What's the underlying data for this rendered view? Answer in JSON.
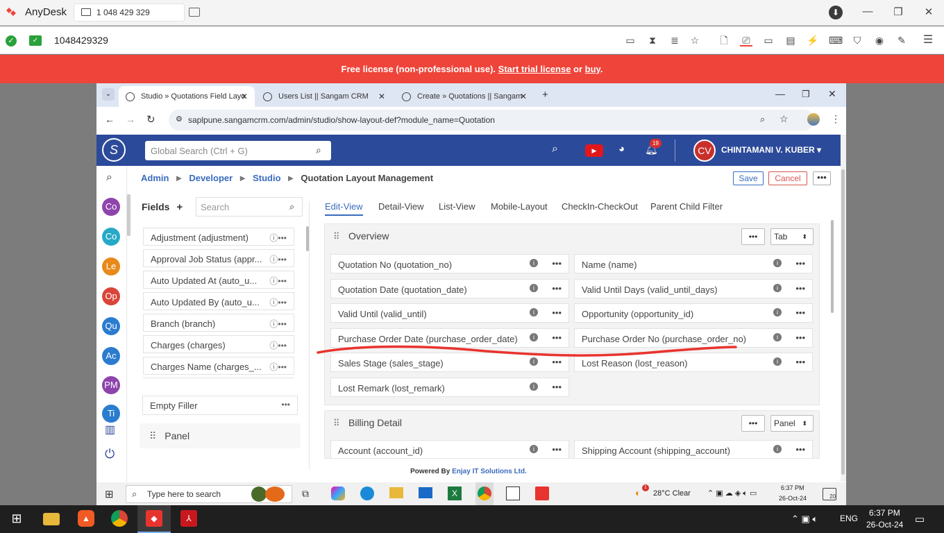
{
  "anydesk": {
    "app_title": "AnyDesk",
    "tab_label": "1 048 429 329",
    "address": "1048429329",
    "banner_prefix": "Free license (non-professional use). ",
    "banner_link1": "Start trial license",
    "banner_mid": " or ",
    "banner_link2": "buy",
    "banner_suffix": "."
  },
  "browser": {
    "tabs": [
      {
        "label": "Studio » Quotations Field Layo"
      },
      {
        "label": "Users List || Sangam CRM"
      },
      {
        "label": "Create » Quotations || Sangam"
      }
    ],
    "url": "saplpune.sangamcrm.com/admin/studio/show-layout-def?module_name=Quotation"
  },
  "crm": {
    "search_placeholder": "Global Search (Ctrl + G)",
    "notification_count": "19",
    "avatar_initials": "CV",
    "user_name": "CHINTAMANI V. KUBER",
    "rail_items": [
      {
        "label": "Co",
        "color": "#8e44ad"
      },
      {
        "label": "Co",
        "color": "#26a9c7"
      },
      {
        "label": "Le",
        "color": "#e8891a"
      },
      {
        "label": "Op",
        "color": "#d9453a"
      },
      {
        "label": "Qu",
        "color": "#2a7ccf"
      },
      {
        "label": "Ac",
        "color": "#2a7ccf"
      },
      {
        "label": "PM",
        "color": "#8e44ad"
      },
      {
        "label": "Ti",
        "color": "#2a7ccf"
      }
    ],
    "breadcrumb": {
      "admin": "Admin",
      "developer": "Developer",
      "studio": "Studio",
      "current": "Quotation Layout Management"
    },
    "actions": {
      "save": "Save",
      "cancel": "Cancel",
      "more": "•••"
    },
    "fields_title": "Fields",
    "fields_search": "Search",
    "field_list": [
      "Adjustment (adjustment)",
      "Approval Job Status (appr...",
      "Auto Updated At (auto_u...",
      "Auto Updated By (auto_u...",
      "Branch (branch)",
      "Charges (charges)",
      "Charges Name (charges_..."
    ],
    "empty_filler": "Empty Filler",
    "panel_label": "Panel",
    "view_tabs": [
      "Edit-View",
      "Detail-View",
      "List-View",
      "Mobile-Layout",
      "CheckIn-CheckOut",
      "Parent Child Filter"
    ],
    "overview": {
      "title": "Overview",
      "type": "Tab",
      "rows": [
        [
          "Quotation No (quotation_no)",
          "Name (name)"
        ],
        [
          "Quotation Date (quotation_date)",
          "Valid Until Days (valid_until_days)"
        ],
        [
          "Valid Until (valid_until)",
          "Opportunity (opportunity_id)"
        ],
        [
          "Purchase Order Date (purchase_order_date)",
          "Purchase Order No (purchase_order_no)"
        ],
        [
          "Sales Stage (sales_stage)",
          "Lost Reason (lost_reason)"
        ],
        [
          "Lost Remark (lost_remark)",
          ""
        ]
      ]
    },
    "billing": {
      "title": "Billing Detail",
      "type": "Panel",
      "rows": [
        [
          "Account (account_id)",
          "Shipping Account (shipping_account)"
        ]
      ]
    },
    "footer_prefix": "Powered By ",
    "footer_company": "Enjay IT Solutions Ltd."
  },
  "remote_taskbar": {
    "search": "Type here to search",
    "weather": "28°C  Clear",
    "weather_badge": "1",
    "time": "6:37 PM",
    "date": "26-Oct-24",
    "notif": "20"
  },
  "local_taskbar": {
    "lang": "ENG",
    "time": "6:37 PM",
    "date": "26-Oct-24"
  }
}
